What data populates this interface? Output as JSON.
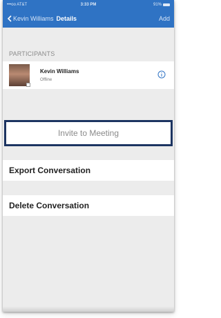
{
  "status_bar": {
    "carrier": "•••oo AT&T",
    "time": "3:33 PM",
    "battery": "91%"
  },
  "nav": {
    "back_label": "Kevin Williams",
    "title": "Details",
    "add_label": "Add"
  },
  "participants": {
    "header": "PARTICIPANTS",
    "items": [
      {
        "name": "Kevin Williams",
        "status": "Offline"
      }
    ]
  },
  "actions": {
    "invite": "Invite to Meeting",
    "export": "Export Conversation",
    "delete": "Delete Conversation"
  },
  "colors": {
    "accent": "#2f73c4",
    "highlight_border": "#1c3461"
  }
}
